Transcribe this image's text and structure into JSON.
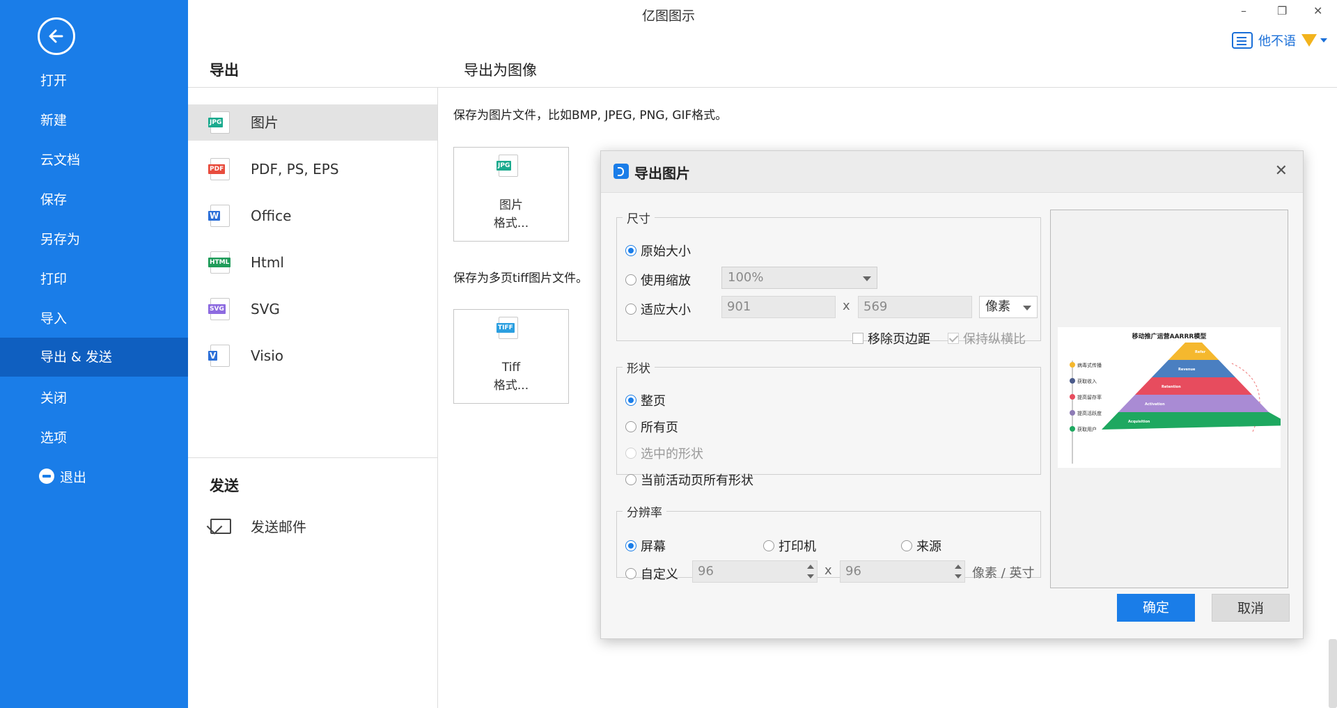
{
  "app": {
    "title": "亿图图示",
    "user_name": "他不语"
  },
  "window": {
    "minimize": "–",
    "restore": "❐",
    "close": "✕"
  },
  "sidebar": {
    "items": [
      {
        "label": "打开"
      },
      {
        "label": "新建"
      },
      {
        "label": "云文档"
      },
      {
        "label": "保存"
      },
      {
        "label": "另存为"
      },
      {
        "label": "打印"
      },
      {
        "label": "导入"
      },
      {
        "label": "导出 & 发送",
        "active": true
      },
      {
        "label": "关闭"
      },
      {
        "label": "选项"
      },
      {
        "label": "退出"
      }
    ]
  },
  "export_panel": {
    "heading": "导出",
    "types": [
      {
        "label": "图片",
        "icon": "jpg-file-icon",
        "tag": "JPG",
        "color": "#1aaa8e",
        "active": true
      },
      {
        "label": "PDF, PS, EPS",
        "icon": "pdf-file-icon",
        "tag": "PDF",
        "color": "#e84c3d"
      },
      {
        "label": "Office",
        "icon": "word-file-icon",
        "tag": "W",
        "color": "#2b6fd8"
      },
      {
        "label": "Html",
        "icon": "html-file-icon",
        "tag": "HTML",
        "color": "#1f9c5a"
      },
      {
        "label": "SVG",
        "icon": "svg-file-icon",
        "tag": "SVG",
        "color": "#8d6be0"
      },
      {
        "label": "Visio",
        "icon": "visio-file-icon",
        "tag": "V",
        "color": "#2b6fd8"
      }
    ],
    "send_heading": "发送",
    "send_mail": "发送邮件"
  },
  "content": {
    "heading": "导出为图像",
    "desc_image": "保存为图片文件，比如BMP, JPEG, PNG, GIF格式。",
    "card_image": {
      "line1": "图片",
      "line2": "格式...",
      "tag": "JPG"
    },
    "desc_tiff": "保存为多页tiff图片文件。",
    "card_tiff": {
      "line1": "Tiff",
      "line2": "格式...",
      "tag": "TIFF"
    }
  },
  "dialog": {
    "title": "导出图片",
    "size": {
      "legend": "尺寸",
      "original": "原始大小",
      "use_zoom": "使用缩放",
      "zoom_value": "100%",
      "fit": "适应大小",
      "width": "901",
      "height": "569",
      "times": "x",
      "unit": "像素",
      "remove_margin": "移除页边距",
      "keep_ratio": "保持纵横比"
    },
    "shape": {
      "legend": "形状",
      "whole_page": "整页",
      "all_pages": "所有页",
      "selected": "选中的形状",
      "current_page": "当前活动页所有形状"
    },
    "resolution": {
      "legend": "分辨率",
      "screen": "屏幕",
      "printer": "打印机",
      "source": "来源",
      "custom": "自定义",
      "x_value": "96",
      "y_value": "96",
      "times": "x",
      "unit": "像素 / 英寸"
    },
    "preview": {
      "title": "移动推广运营AARRR模型",
      "left_items": [
        "病毒式传播",
        "获取收入",
        "提高留存率",
        "提高活跃度",
        "获取用户"
      ],
      "layers": [
        {
          "label": "Refer",
          "color": "#f5b82e"
        },
        {
          "label": "Revenue",
          "color": "#4a7fc1"
        },
        {
          "label": "Retention",
          "color": "#e74c5e"
        },
        {
          "label": "Activation",
          "color": "#a98bd4"
        },
        {
          "label": "Acquisition",
          "color": "#1ea860"
        }
      ]
    },
    "ok": "确定",
    "cancel": "取消"
  }
}
